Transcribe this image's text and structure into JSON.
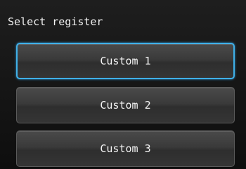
{
  "header": {
    "title": "Select register"
  },
  "registers": [
    {
      "label": "Custom 1",
      "selected": true
    },
    {
      "label": "Custom 2",
      "selected": false
    },
    {
      "label": "Custom 3",
      "selected": false
    }
  ],
  "colors": {
    "selection_border": "#3fb0e8",
    "background": "#141414",
    "text": "#f2f2f2"
  }
}
